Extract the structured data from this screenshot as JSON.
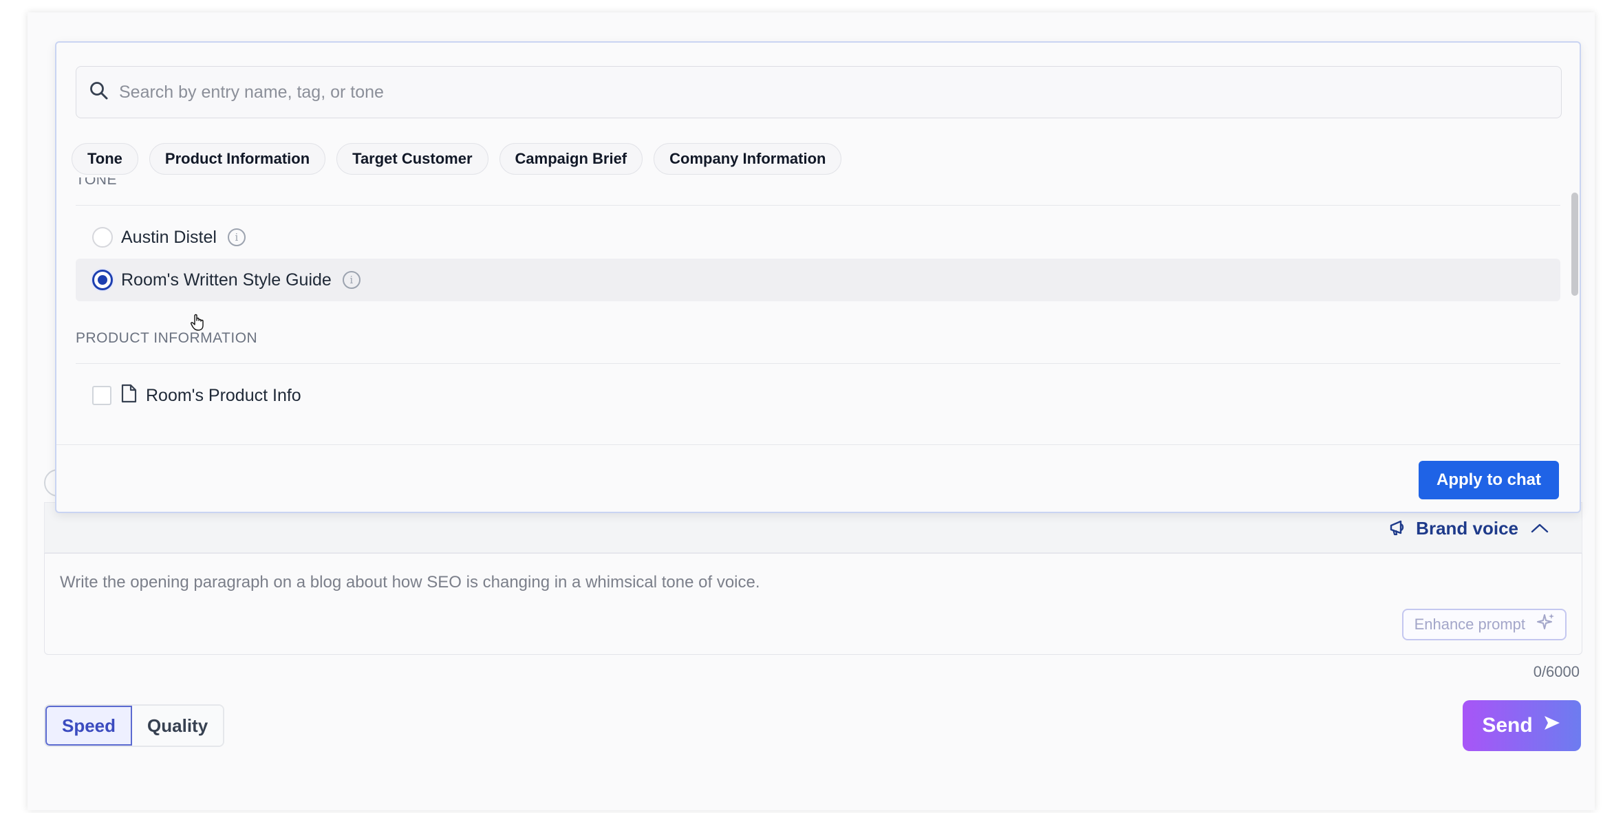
{
  "popover": {
    "search_placeholder": "Search by entry name, tag, or tone",
    "chips": [
      "Tone",
      "Product Information",
      "Target Customer",
      "Campaign Brief",
      "Company Information"
    ],
    "sections": {
      "tone": {
        "title": "TONE",
        "items": [
          {
            "label": "Austin Distel",
            "selected": false
          },
          {
            "label": "Room's Written Style Guide",
            "selected": true
          }
        ]
      },
      "product": {
        "title": "PRODUCT INFORMATION",
        "items": [
          {
            "label": "Room's Product Info",
            "checked": false
          }
        ]
      }
    },
    "apply_label": "Apply to chat"
  },
  "brand_voice": {
    "label": "Brand voice"
  },
  "prompt": {
    "placeholder": "Write the opening paragraph on a blog about how SEO is changing in a whimsical tone of voice.",
    "enhance_label": "Enhance prompt",
    "char_count": "0/6000"
  },
  "mode": {
    "options": [
      "Speed",
      "Quality"
    ],
    "active": "Speed"
  },
  "send_label": "Send",
  "colors": {
    "accent": "#1f63e6",
    "radio_selected": "#1d3fb0",
    "send_gradient_start": "#a855f7",
    "send_gradient_end": "#6d7cf0"
  }
}
